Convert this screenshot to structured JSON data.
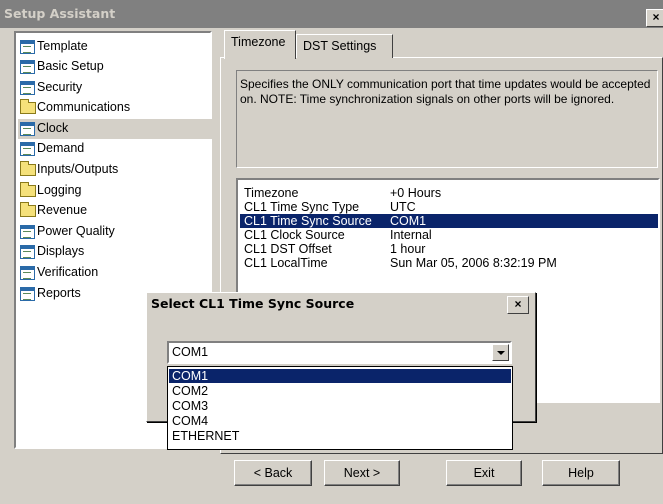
{
  "window": {
    "title": "Setup Assistant",
    "close_glyph": "×"
  },
  "tree": {
    "items": [
      {
        "label": "Template",
        "icon": "document-icon"
      },
      {
        "label": "Basic Setup",
        "icon": "document-icon"
      },
      {
        "label": "Security",
        "icon": "document-icon"
      },
      {
        "label": "Communications",
        "icon": "folder-icon"
      },
      {
        "label": "Clock",
        "icon": "document-icon",
        "selected": true
      },
      {
        "label": "Demand",
        "icon": "document-icon"
      },
      {
        "label": "Inputs/Outputs",
        "icon": "folder-icon"
      },
      {
        "label": "Logging",
        "icon": "folder-icon"
      },
      {
        "label": "Revenue",
        "icon": "folder-icon"
      },
      {
        "label": "Power Quality",
        "icon": "document-icon"
      },
      {
        "label": "Displays",
        "icon": "document-icon"
      },
      {
        "label": "Verification",
        "icon": "document-icon"
      },
      {
        "label": "Reports",
        "icon": "document-icon"
      }
    ]
  },
  "tabs": [
    {
      "label": "Timezone",
      "active": true
    },
    {
      "label": "DST Settings",
      "active": false
    }
  ],
  "description": "Specifies the ONLY communication port that time updates would be accepted on.  NOTE: Time synchronization signals on other ports will be ignored.",
  "settings": {
    "rows": [
      {
        "key": "Timezone",
        "value": "+0 Hours"
      },
      {
        "key": "CL1 Time Sync Type",
        "value": "UTC"
      },
      {
        "key": "CL1 Time Sync Source",
        "value": "COM1",
        "selected": true
      },
      {
        "key": "CL1 Clock Source",
        "value": "Internal"
      },
      {
        "key": "CL1 DST Offset",
        "value": "1 hour"
      },
      {
        "key": "CL1 LocalTime",
        "value": "Sun Mar 05, 2006 8:32:19 PM"
      }
    ]
  },
  "buttons": {
    "back": "< Back",
    "next": "Next >",
    "exit": "Exit",
    "help": "Help"
  },
  "dialog": {
    "title": "Select CL1 Time Sync Source",
    "close_glyph": "×",
    "combo_value": "COM1",
    "options": [
      "COM1",
      "COM2",
      "COM3",
      "COM4",
      "ETHERNET"
    ],
    "selected_index": 0
  },
  "colors": {
    "selection": "#0a246a",
    "face": "#d4d0c8",
    "title_inactive": "#808080"
  }
}
